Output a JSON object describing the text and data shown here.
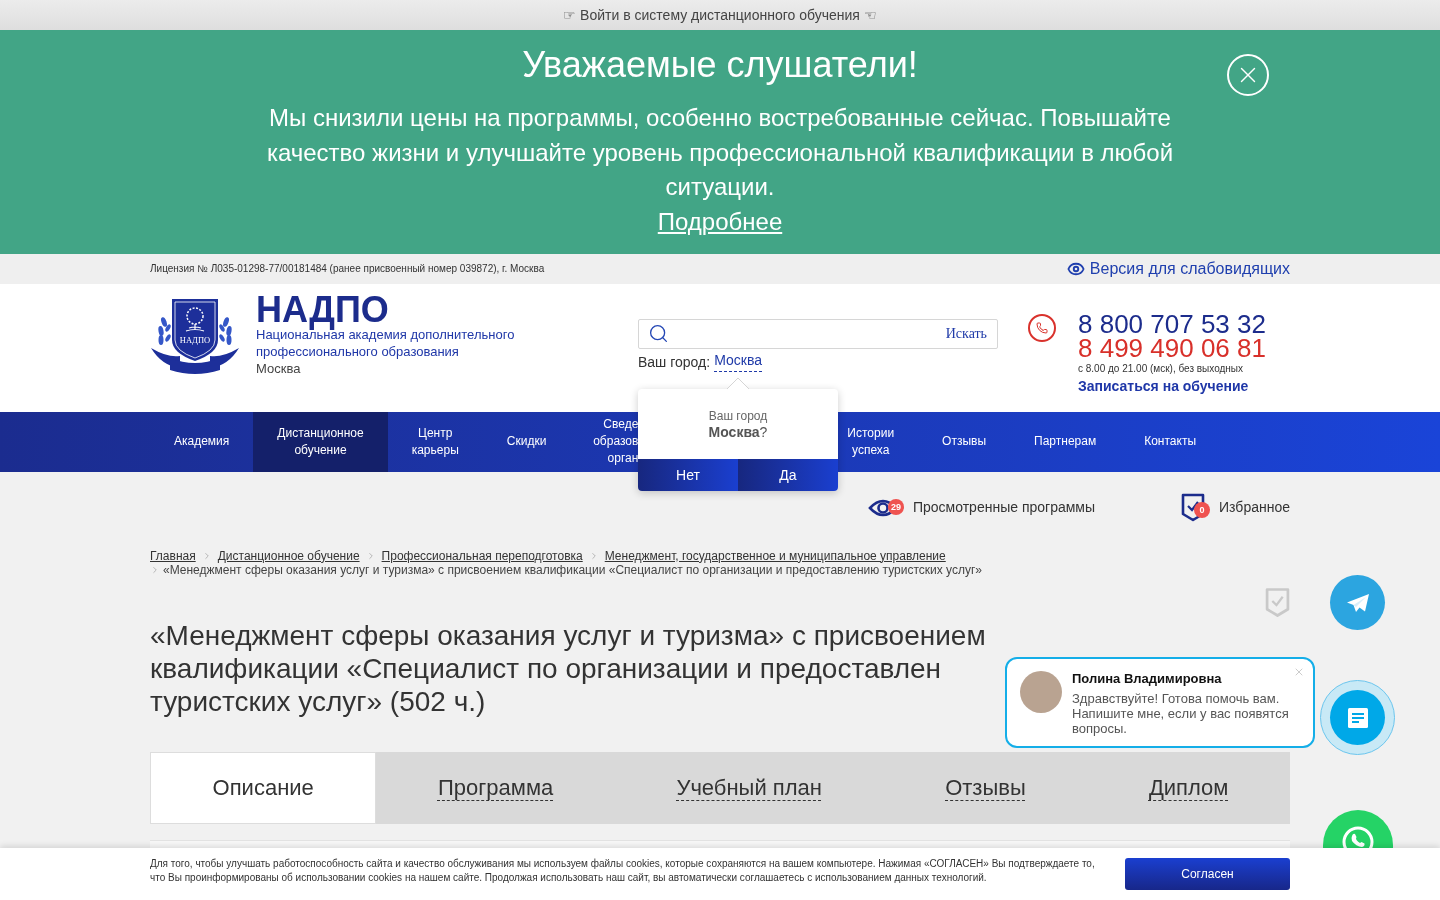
{
  "top_bar": {
    "link": "☞ Войти в систему дистанционного обучения ☜"
  },
  "announcement": {
    "title": "Уважаемые слушатели!",
    "text": "Мы снизили цены на программы, особенно востребованные сейчас. Повышайте качество жизни и улучшайте уровень профессиональной квалификации в любой ситуации.",
    "link": "Подробнее"
  },
  "info_bar": {
    "license": "Лицензия № Л035-01298-77/00181484 (ранее присвоенный номер 039872), г. Москва",
    "low_vision_link": "Версия для слабовидящих"
  },
  "header": {
    "logo": {
      "emblem_text": "НАДПО",
      "title": "НАДПО",
      "subtitle": "Национальная академия дополнительного профессионального образования",
      "city": "Москва"
    },
    "search": {
      "button": "Искать"
    },
    "city": {
      "label": "Ваш город:",
      "value": "Москва"
    },
    "phones": [
      {
        "number": "8 800 707 53 32",
        "color": "#1c2c8c"
      },
      {
        "number": "8 499 490 06 81",
        "color": "#d8302a"
      }
    ],
    "hours": "с 8.00 до 21.00 (мск), без выходных",
    "signup_link": "Записаться на обучение"
  },
  "nav": [
    {
      "label": "Академия",
      "kind": "link",
      "selected": false
    },
    {
      "label": "Дистанционное обучение",
      "kind": "link",
      "selected": true
    },
    {
      "label": "Центр карьеры",
      "kind": "link",
      "selected": false
    },
    {
      "label": "Скидки",
      "kind": "link",
      "selected": false
    },
    {
      "label": "Сведе образов орган",
      "kind": "covered",
      "selected": false
    },
    {
      "label": "Истории успеха",
      "kind": "link",
      "selected": false
    },
    {
      "label": "Отзывы",
      "kind": "link",
      "selected": false
    },
    {
      "label": "Партнерам",
      "kind": "link",
      "selected": false
    },
    {
      "label": "Контакты",
      "kind": "link",
      "selected": false
    }
  ],
  "city_popup": {
    "question": "Ваш город",
    "city": "**Москва**?",
    "buttons": [
      "Нет",
      "Да"
    ]
  },
  "shortcuts": [
    {
      "kind": "viewed",
      "label": "Просмотренные программы",
      "count": "29"
    },
    {
      "kind": "favorites",
      "label": "Избранное",
      "count": "0"
    }
  ],
  "breadcrumbs": {
    "links": [
      "Главная",
      "Дистанционное обучение",
      "Профессиональная переподготовка",
      "Менеджмент, государственное и муниципальное управление"
    ],
    "current": "«Менеджмент сферы оказания услуг и туризма» с присвоением квалификации «Специалист по организации и предоставлению туристских услуг»"
  },
  "page_title": "«Менеджмент сферы оказания услуг и туризма» с присвоением квалификации «Специалист по организации и предоставлен туристских услуг» (502 ч.)",
  "tabs": [
    {
      "label": "Описание",
      "selected": true
    },
    {
      "label": "Программа",
      "selected": false
    },
    {
      "label": "Учебный план",
      "selected": false
    },
    {
      "label": "Отзывы",
      "selected": false
    },
    {
      "label": "Диплом",
      "selected": false
    }
  ],
  "chat": {
    "name": "Полина Владимировна",
    "message": "Здравствуйте! Готова помочь вам. Напишите мне, если у вас появятся вопросы."
  },
  "cookie_notice": {
    "text": "Для того, чтобы улучшать работоспособность сайта и качество обслуживания мы используем файлы cookies, которые сохраняются на вашем компьютере. Нажимая «СОГЛАСЕН» Вы подтверждаете то, что Вы проинформированы об использовании cookies на нашем сайте. Продолжая использовать наш сайт, вы автоматически соглашаетесь с использованием данных технологий.",
    "button": "Согласен"
  }
}
